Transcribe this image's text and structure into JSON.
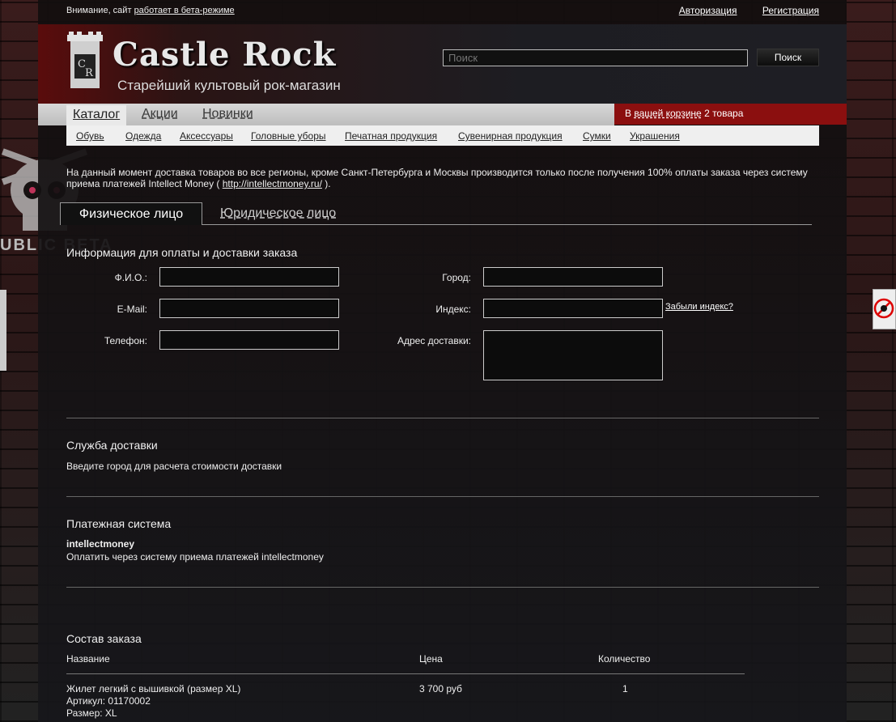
{
  "topbar": {
    "notice_prefix": "Внимание, сайт",
    "notice_link": "работает в бета-режиме",
    "login": "Авторизация",
    "register": "Регистрация"
  },
  "header": {
    "title": "Castle Rock",
    "subtitle": "Старейший культовый рок-магазин",
    "search_placeholder": "Поиск",
    "search_button": "Поиск",
    "beta_badge": "UBLIC BETA"
  },
  "nav": {
    "tabs": [
      "Каталог",
      "Акции",
      "Новинки"
    ],
    "cart_prefix": "В",
    "cart_link": "вашей корзине",
    "cart_suffix": "2 товара",
    "subnav": [
      "Обувь",
      "Одежда",
      "Аксессуары",
      "Головные уборы",
      "Печатная продукция",
      "Сувенирная продукция",
      "Сумки",
      "Украшения"
    ]
  },
  "notice": {
    "text": "На данный момент доставка товаров во все регионы, кроме Санкт-Петербурга и Москвы производится только после получения 100% оплаты заказа через систему приема платежей Intellect Money (",
    "link": "http://intellectmoney.ru/",
    "end": ")."
  },
  "tabs": {
    "physical": "Физическое лицо",
    "legal": "Юридическое лицо"
  },
  "form": {
    "title": "Информация для оплаты и доставки заказа",
    "fio": "Ф.И.О.:",
    "email": "E-Mail:",
    "phone": "Телефон:",
    "city": "Город:",
    "index": "Индекс:",
    "forgot_index": "Забыли индекс?",
    "address": "Адрес доставки:"
  },
  "delivery": {
    "title": "Служба доставки",
    "hint": "Введите город для расчета стоимости доставки"
  },
  "payment": {
    "title": "Платежная система",
    "method": "intellectmoney",
    "description": "Оплатить через систему приема платежей intellectmoney"
  },
  "order": {
    "title": "Состав заказа",
    "columns": [
      "Название",
      "Цена",
      "Количество"
    ],
    "items": [
      {
        "name": "Жилет легкий с вышивкой (размер XL)",
        "article": "Артикул: 01170002",
        "size": "Размер: XL",
        "price": "3 700 руб",
        "qty": "1"
      }
    ]
  }
}
